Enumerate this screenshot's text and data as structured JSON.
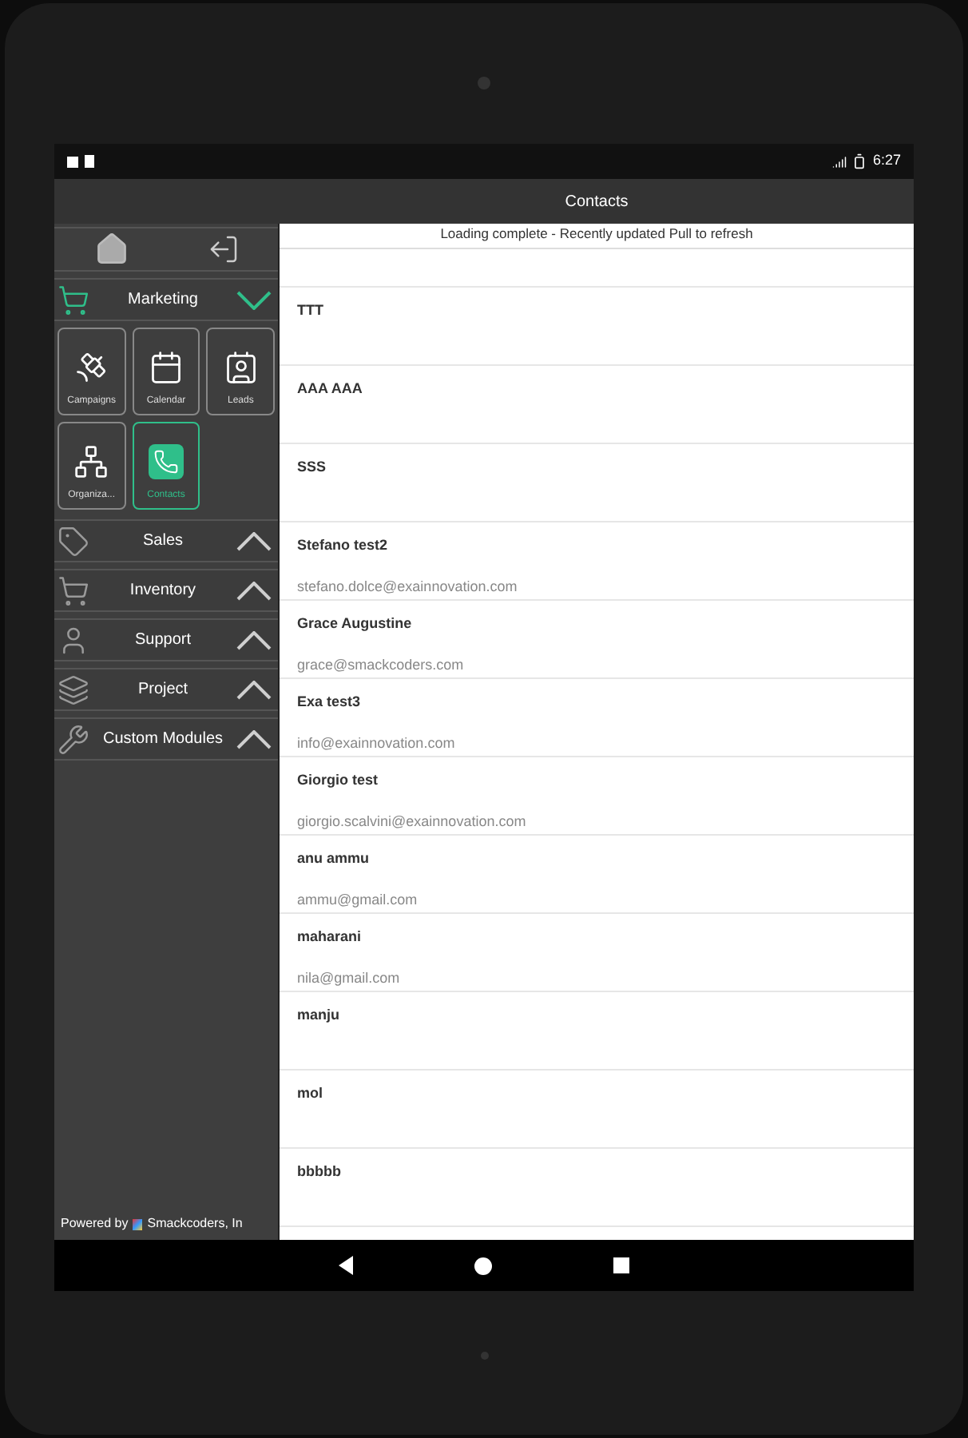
{
  "status_bar": {
    "time": "6:27"
  },
  "app_bar": {
    "title": "Contacts"
  },
  "sidebar": {
    "groups": [
      {
        "label": "Marketing",
        "expanded": true,
        "tiles": [
          {
            "label": "Campaigns",
            "selected": false
          },
          {
            "label": "Calendar",
            "selected": false
          },
          {
            "label": "Leads",
            "selected": false
          },
          {
            "label": "Organiza...",
            "selected": false
          },
          {
            "label": "Contacts",
            "selected": true
          }
        ]
      },
      {
        "label": "Sales",
        "expanded": false
      },
      {
        "label": "Inventory",
        "expanded": false
      },
      {
        "label": "Support",
        "expanded": false
      },
      {
        "label": "Project",
        "expanded": false
      },
      {
        "label": "Custom Modules",
        "expanded": false
      }
    ],
    "footer": {
      "prefix": "Powered by",
      "brand": "Smackcoders, In"
    }
  },
  "list": {
    "notice": "Loading complete - Recently updated Pull to refresh",
    "contacts": [
      {
        "name": "TTT"
      },
      {
        "name": "AAA AAA"
      },
      {
        "name": "SSS"
      },
      {
        "name": "Stefano test2",
        "email": "stefano.dolce@exainnovation.com"
      },
      {
        "name": "Grace Augustine",
        "email": "grace@smackcoders.com"
      },
      {
        "name": "Exa test3",
        "email": "info@exainnovation.com"
      },
      {
        "name": "Giorgio test",
        "email": "giorgio.scalvini@exainnovation.com"
      },
      {
        "name": "anu ammu",
        "email": "ammu@gmail.com"
      },
      {
        "name": "maharani",
        "email": "nila@gmail.com"
      },
      {
        "name": "manju"
      },
      {
        "name": "mol"
      },
      {
        "name": "bbbbb"
      }
    ]
  }
}
